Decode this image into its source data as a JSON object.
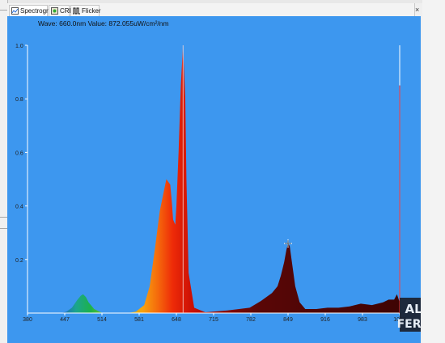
{
  "tabs": [
    {
      "label": "Spectrogram",
      "icon": "spectrogram-icon",
      "active": true
    },
    {
      "label": "CRI",
      "icon": "cri-icon",
      "active": false
    },
    {
      "label": "Flicker",
      "icon": "flicker-icon",
      "active": false
    }
  ],
  "close_glyph": "×",
  "readout": "Wave: 660.0nm Value: 872.055uW/cm²/nm",
  "watermark": {
    "line1": "ALEX",
    "line2": "FERGUS"
  },
  "colors": {
    "plot_bg": "#3d97ef",
    "axis": "#ffffff",
    "marker": "#ff3b3b"
  },
  "chart_data": {
    "type": "area",
    "title": "",
    "xlabel": "",
    "ylabel": "",
    "xlim": [
      380,
      1050
    ],
    "ylim": [
      0,
      1.0
    ],
    "x_ticks": [
      "380",
      "447",
      "514",
      "581",
      "648",
      "715",
      "782",
      "849",
      "916",
      "983",
      "1050"
    ],
    "y_ticks": [
      "0.2",
      "0.4",
      "0.6",
      "0.8",
      "1.0"
    ],
    "grid": false,
    "cursor": {
      "x": 849,
      "y": 0.26
    },
    "marker_x": 1050,
    "series": [
      {
        "x": [
          380,
          440,
          450,
          460,
          470,
          476,
          480,
          485,
          490,
          500,
          515,
          560,
          575,
          590,
          600,
          610,
          618,
          622,
          630,
          637,
          640,
          642,
          646,
          648,
          652,
          656,
          660,
          664,
          666,
          670,
          680,
          700,
          740,
          780,
          800,
          820,
          830,
          836,
          842,
          846,
          849,
          852,
          856,
          862,
          870,
          880,
          900,
          920,
          940,
          960,
          980,
          1000,
          1020,
          1030,
          1040,
          1045,
          1050
        ],
        "y": [
          0,
          0,
          0.005,
          0.02,
          0.05,
          0.065,
          0.07,
          0.06,
          0.04,
          0.015,
          0,
          0,
          0.005,
          0.03,
          0.1,
          0.25,
          0.38,
          0.42,
          0.5,
          0.48,
          0.41,
          0.35,
          0.33,
          0.4,
          0.6,
          0.85,
          1.0,
          0.8,
          0.5,
          0.15,
          0.02,
          0.003,
          0.01,
          0.02,
          0.045,
          0.075,
          0.1,
          0.14,
          0.19,
          0.235,
          0.26,
          0.25,
          0.19,
          0.1,
          0.04,
          0.015,
          0.015,
          0.02,
          0.02,
          0.025,
          0.035,
          0.03,
          0.04,
          0.05,
          0.05,
          0.07,
          0.04
        ]
      }
    ]
  }
}
